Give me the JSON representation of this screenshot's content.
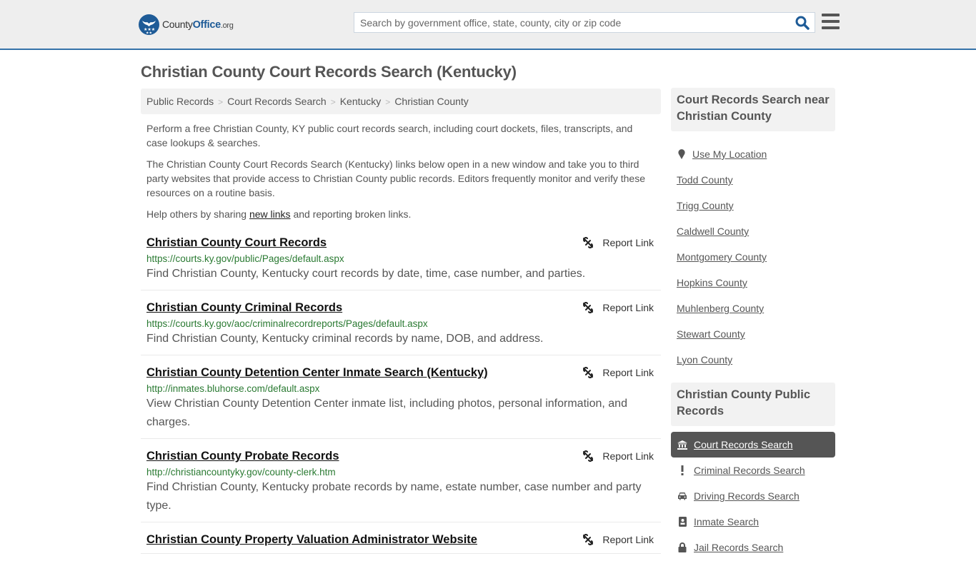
{
  "header": {
    "logo": {
      "county": "County",
      "office": "Office",
      "tld": ".org"
    },
    "search_placeholder": "Search by government office, state, county, city or zip code",
    "search_icon": "search-icon",
    "menu_icon": "hamburger-menu-icon"
  },
  "page": {
    "title": "Christian County Court Records Search (Kentucky)"
  },
  "breadcrumb": [
    {
      "label": "Public Records"
    },
    {
      "label": "Court Records Search"
    },
    {
      "label": "Kentucky"
    },
    {
      "label": "Christian County"
    }
  ],
  "breadcrumb_separator": ">",
  "intro": {
    "p1": "Perform a free Christian County, KY public court records search, including court dockets, files, transcripts, and case lookups & searches.",
    "p2": "The Christian County Court Records Search (Kentucky) links below open in a new window and take you to third party websites that provide access to Christian County public records. Editors frequently monitor and verify these resources on a routine basis.",
    "p3_before": "Help others by sharing ",
    "p3_link": "new links",
    "p3_after": " and reporting broken links."
  },
  "report_label": "Report Link",
  "results": [
    {
      "title": "Christian County Court Records",
      "url": "https://courts.ky.gov/public/Pages/default.aspx",
      "desc": "Find Christian County, Kentucky court records by date, time, case number, and parties."
    },
    {
      "title": "Christian County Criminal Records",
      "url": "https://courts.ky.gov/aoc/criminalrecordreports/Pages/default.aspx",
      "desc": "Find Christian County, Kentucky criminal records by name, DOB, and address."
    },
    {
      "title": "Christian County Detention Center Inmate Search (Kentucky)",
      "url": "http://inmates.bluhorse.com/default.aspx",
      "desc": "View Christian County Detention Center inmate list, including photos, personal information, and charges."
    },
    {
      "title": "Christian County Probate Records",
      "url": "http://christiancountyky.gov/county-clerk.htm",
      "desc": "Find Christian County, Kentucky probate records by name, estate number, case number and party type."
    },
    {
      "title": "Christian County Property Valuation Administrator Website",
      "url": "",
      "desc": ""
    }
  ],
  "sidebar": {
    "near": {
      "heading": "Court Records Search near Christian County",
      "use_location": "Use My Location",
      "counties": [
        "Todd County",
        "Trigg County",
        "Caldwell County",
        "Montgomery County",
        "Hopkins County",
        "Muhlenberg County",
        "Stewart County",
        "Lyon County"
      ]
    },
    "public_records": {
      "heading": "Christian County Public Records",
      "items": [
        {
          "label": "Court Records Search",
          "icon": "courthouse-icon",
          "active": true
        },
        {
          "label": "Criminal Records Search",
          "icon": "exclamation-icon",
          "active": false
        },
        {
          "label": "Driving Records Search",
          "icon": "car-icon",
          "active": false
        },
        {
          "label": "Inmate Search",
          "icon": "id-badge-icon",
          "active": false
        },
        {
          "label": "Jail Records Search",
          "icon": "lock-icon",
          "active": false
        }
      ]
    }
  },
  "colors": {
    "brand_blue": "#1e5b97",
    "header_border": "#3572a8",
    "url_green": "#2a7a32",
    "active_item_bg": "#555555"
  }
}
